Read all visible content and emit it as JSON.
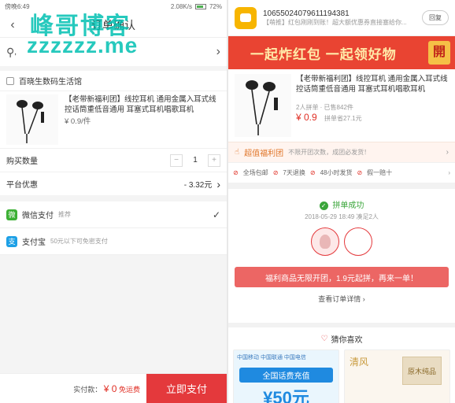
{
  "left": {
    "statusbar": {
      "time": "傍晚6:49",
      "speed": "2.08K/s",
      "battery": "72%"
    },
    "header": {
      "title": "订单确认",
      "back": "‹"
    },
    "watermark": {
      "line1": "峰哥博客",
      "line2": "zzzzzz.me"
    },
    "address": {
      "text": ",",
      "chevron": "›"
    },
    "shop": {
      "name": "百晓生数码生活馆"
    },
    "product": {
      "title": "【老带新福利团】线控耳机 通用金属入耳式线控话筒重低音通用 耳塞式耳机唱歌耳机",
      "price": "¥ 0.9/件"
    },
    "quantity": {
      "label": "购买数量",
      "minus": "−",
      "value": "1",
      "plus": "+"
    },
    "discount": {
      "label": "平台优惠",
      "value": "- 3.32元",
      "chevron": "›"
    },
    "payments": [
      {
        "name": "微信支付",
        "sub": "推荐",
        "checked": "✓",
        "color": "#3cb034",
        "icon_glyph": "微"
      },
      {
        "name": "支付宝",
        "sub": "50元以下可免密支付",
        "checked": "",
        "color": "#1da0e6",
        "icon_glyph": "支"
      }
    ],
    "bottom": {
      "paid_label": "实付款：",
      "amount": "¥ 0",
      "free_ship": "免运费",
      "submit": "立即支付"
    }
  },
  "right": {
    "sms": {
      "number": "10655024079611194381",
      "message": "【萌推】红包刚刚到账！超大额优惠券直接塞给你...",
      "reply": "回复"
    },
    "banner": {
      "text": "一起炸红包 一起领好物",
      "tag": "開"
    },
    "product": {
      "title": "【老带新福利团】线控耳机 通用金属入耳式线控话筒重低音通用 耳塞式耳机唱歌耳机",
      "meta": "2人拼单 · 已售842件",
      "price": "¥ 0.9",
      "orig_price": "拼单省27.1元"
    },
    "welfare": {
      "title": "超值福利团",
      "desc": "不限开团次数，成团必发货！",
      "chevron": "›"
    },
    "guarantees": [
      "全场包邮",
      "7天退换",
      "48小时发货",
      "假一赔十"
    ],
    "guarantee_chevron": "›",
    "success": {
      "title": "拼单成功",
      "time": "2018-05-29 18:49 凑足2人",
      "cta": "福利商品无限开团，1.9元起拼，再来一单！",
      "view_order": "查看订单详情 ›"
    },
    "guess": {
      "title": "猜你喜欢",
      "heart": "♡"
    },
    "cards": [
      {
        "logos": "中国移动 中国联通 中国电信",
        "headline": "全国话费充值",
        "value": "¥50元"
      },
      {
        "brand": "清风",
        "box_text": "原木纯品"
      }
    ]
  },
  "colors": {
    "accent": "#e4393c",
    "watermark": "#00bfb2",
    "success": "#3aa53a",
    "banner": "#e94432"
  }
}
